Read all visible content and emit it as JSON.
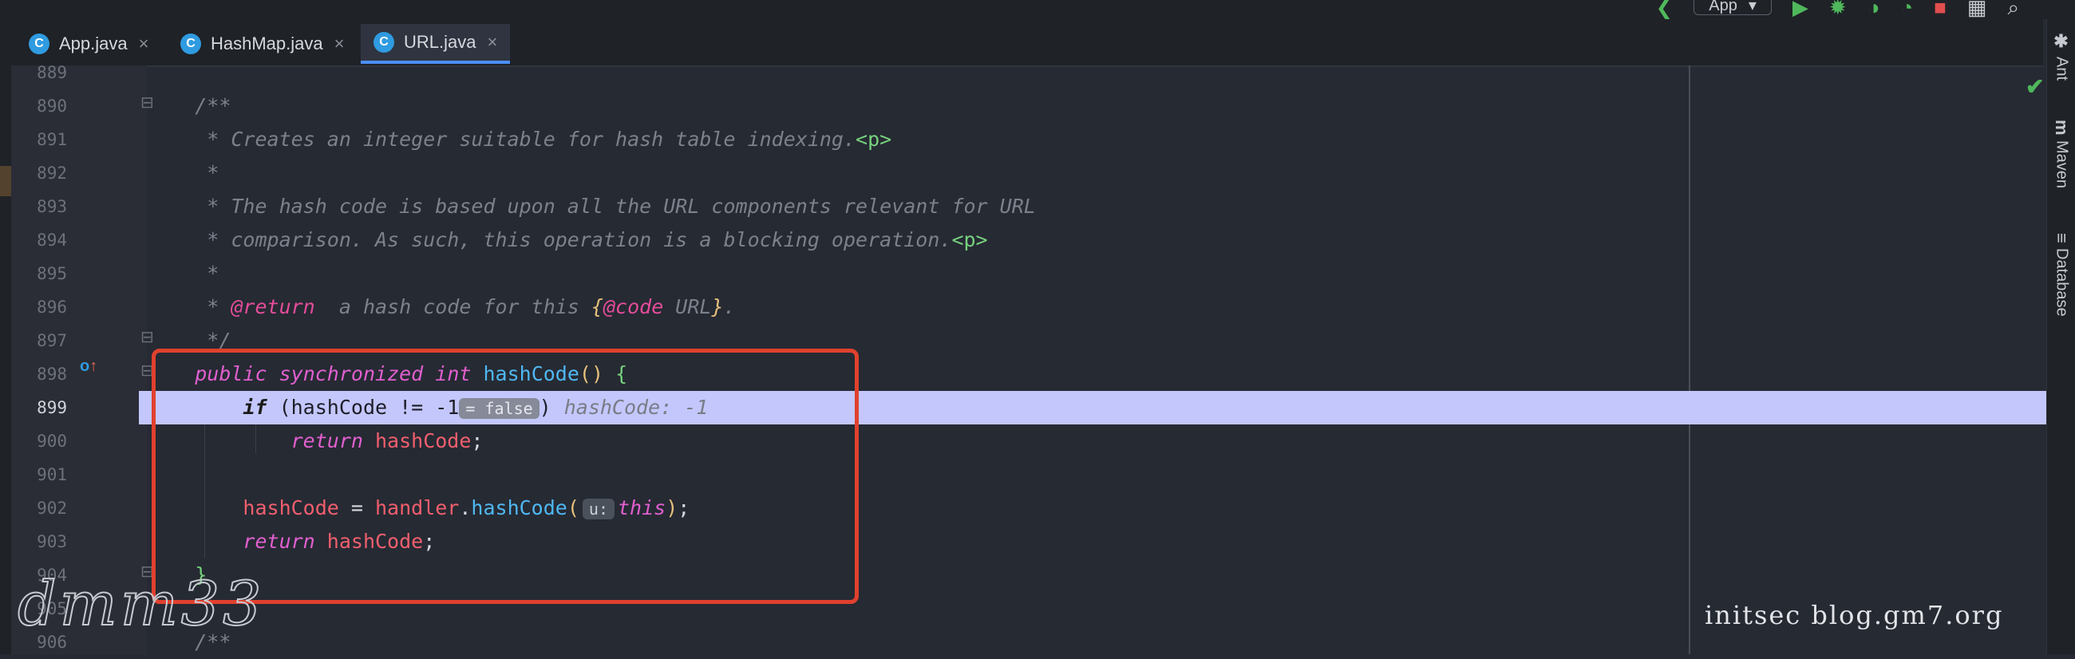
{
  "run_config": {
    "label": "App",
    "caret": "▾"
  },
  "toolbar_icons": [
    "back-icon",
    "run-icon",
    "debug-icon",
    "coverage-icon",
    "profile-icon",
    "stop-icon",
    "project-structure-icon",
    "search-icon"
  ],
  "tabs": [
    {
      "label": "App.java",
      "icon": "C",
      "close": "×"
    },
    {
      "label": "HashMap.java",
      "icon": "C",
      "close": "×"
    },
    {
      "label": "URL.java",
      "icon": "C",
      "close": "×"
    }
  ],
  "line_numbers": [
    "889",
    "890",
    "891",
    "892",
    "893",
    "894",
    "895",
    "896",
    "897",
    "898",
    "899",
    "900",
    "901",
    "902",
    "903",
    "904",
    "905",
    "906"
  ],
  "code": {
    "l890": "/**",
    "l891_text": " * Creates an integer suitable for hash table indexing.",
    "l891_tag": "<p>",
    "l892": " *",
    "l893": " * The hash code is based upon all the URL components relevant for URL",
    "l894_text": " * comparison. As such, this operation is a blocking operation.",
    "l894_tag": "<p>",
    "l895": " *",
    "l896_star": " * ",
    "l896_tag": "@return",
    "l896_text": "  a hash code for this ",
    "l896_brace_open": "{",
    "l896_code": "@code",
    "l896_url": " URL",
    "l896_brace_close": "}",
    "l896_dot": ".",
    "l897": " */",
    "l898_kw1": "public",
    "l898_kw2": "synchronized",
    "l898_kw3": "int",
    "l898_fn": "hashCode",
    "l898_parens": "()",
    "l898_brace": "{",
    "l899_if": "if",
    "l899_cond": " (hashCode != -1",
    "l899_hint": "= false",
    "l899_close": ")",
    "l899_debug": "hashCode: -1",
    "l900_return": "return",
    "l900_field": "hashCode",
    "l900_semi": ";",
    "l902_field": "hashCode",
    "l902_eq": " = ",
    "l902_handler": "handler",
    "l902_dot": ".",
    "l902_fn": "hashCode",
    "l902_open": "(",
    "l902_hint": "u:",
    "l902_this": "this",
    "l902_close": ")",
    "l902_semi": ";",
    "l903_return": "return",
    "l903_field": "hashCode",
    "l903_semi": ";",
    "l904": "}",
    "l906": "/**"
  },
  "right_panel": {
    "ant": "Ant",
    "maven_icon": "m",
    "maven": "Maven",
    "database_icon": "≡",
    "database": "Database"
  },
  "inspection_ok": "✔",
  "watermark_left": "dmm33",
  "watermark_right": "initsec blog.gm7.org",
  "colors": {
    "highlight_box": "#e0412e",
    "current_line": "#c3c7fc",
    "keyword": "#e15fcf",
    "function": "#4fb8f2",
    "field": "#f15f6e"
  }
}
